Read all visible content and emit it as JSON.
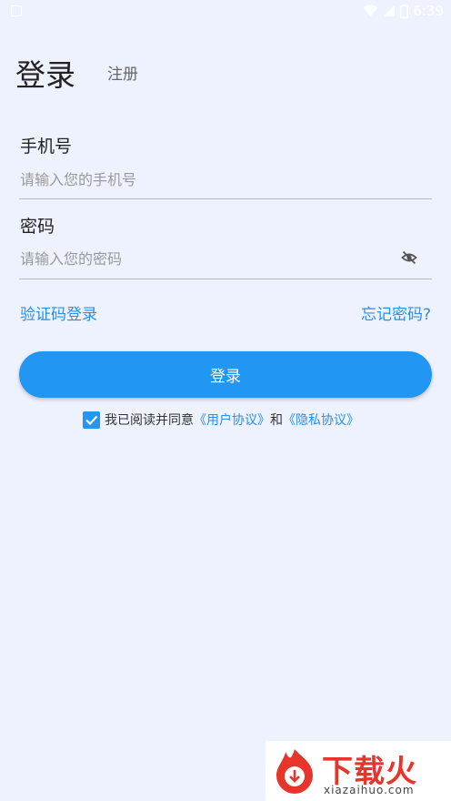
{
  "status_bar": {
    "time": "6:39"
  },
  "tabs": {
    "login": "登录",
    "register": "注册"
  },
  "phone": {
    "label": "手机号",
    "placeholder": "请输入您的手机号"
  },
  "password": {
    "label": "密码",
    "placeholder": "请输入您的密码"
  },
  "links": {
    "sms_login": "验证码登录",
    "forgot_password": "忘记密码?"
  },
  "login_button": "登录",
  "agreement": {
    "checked": true,
    "prefix": "我已阅读并同意",
    "user_agreement": "《用户协议》",
    "conjunction": "和",
    "privacy_policy": "《隐私协议》"
  },
  "watermark": {
    "title": "下载火",
    "subtitle": "xiazaihuo.com"
  },
  "colors": {
    "background": "#eef1fe",
    "primary": "#2196f3",
    "link": "#2a8fe9",
    "watermark_red": "#e8352b"
  }
}
